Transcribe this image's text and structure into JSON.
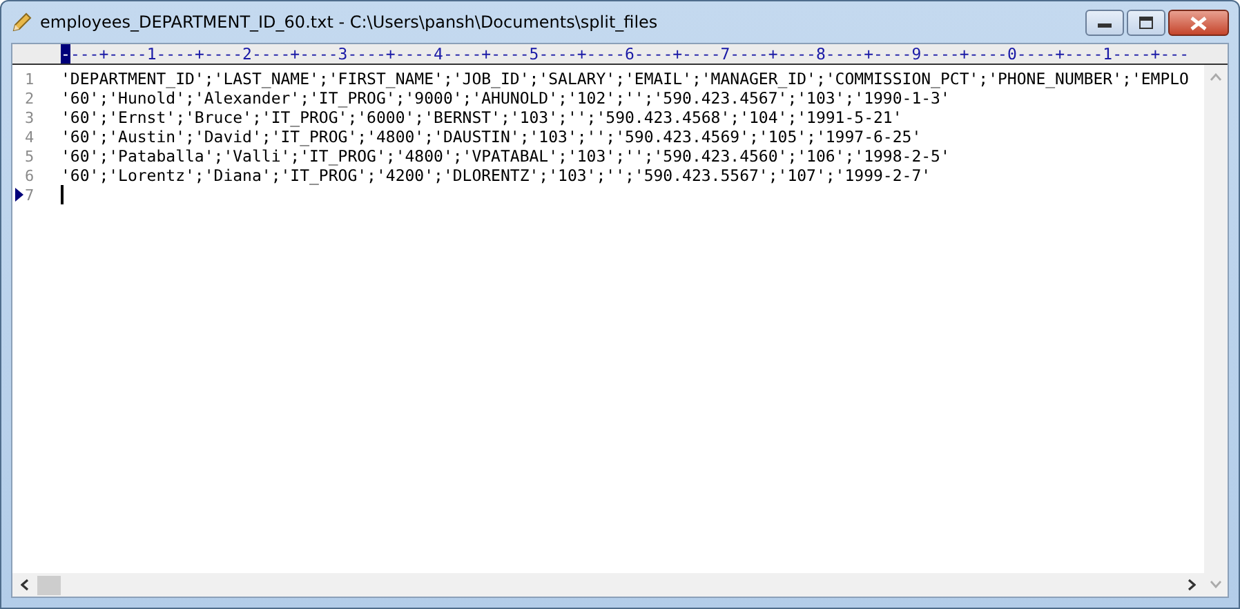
{
  "window": {
    "title": "employees_DEPARTMENT_ID_60.txt - C:\\Users\\pansh\\Documents\\split_files"
  },
  "ruler": {
    "marker": "-",
    "scale": "---+----1----+----2----+----3----+----4----+----5----+----6----+----7----+----8----+----9----+----0----+----1----+---"
  },
  "lines": [
    {
      "number": "1",
      "text": "'DEPARTMENT_ID';'LAST_NAME';'FIRST_NAME';'JOB_ID';'SALARY';'EMAIL';'MANAGER_ID';'COMMISSION_PCT';'PHONE_NUMBER';'EMPLO",
      "current": false
    },
    {
      "number": "2",
      "text": "'60';'Hunold';'Alexander';'IT_PROG';'9000';'AHUNOLD';'102';'';'590.423.4567';'103';'1990-1-3'",
      "current": false
    },
    {
      "number": "3",
      "text": "'60';'Ernst';'Bruce';'IT_PROG';'6000';'BERNST';'103';'';'590.423.4568';'104';'1991-5-21'",
      "current": false
    },
    {
      "number": "4",
      "text": "'60';'Austin';'David';'IT_PROG';'4800';'DAUSTIN';'103';'';'590.423.4569';'105';'1997-6-25'",
      "current": false
    },
    {
      "number": "5",
      "text": "'60';'Pataballa';'Valli';'IT_PROG';'4800';'VPATABAL';'103';'';'590.423.4560';'106';'1998-2-5'",
      "current": false
    },
    {
      "number": "6",
      "text": "'60';'Lorentz';'Diana';'IT_PROG';'4200';'DLORENTZ';'103';'';'590.423.5567';'107';'1999-2-7'",
      "current": false
    },
    {
      "number": "7",
      "current": true
    }
  ]
}
